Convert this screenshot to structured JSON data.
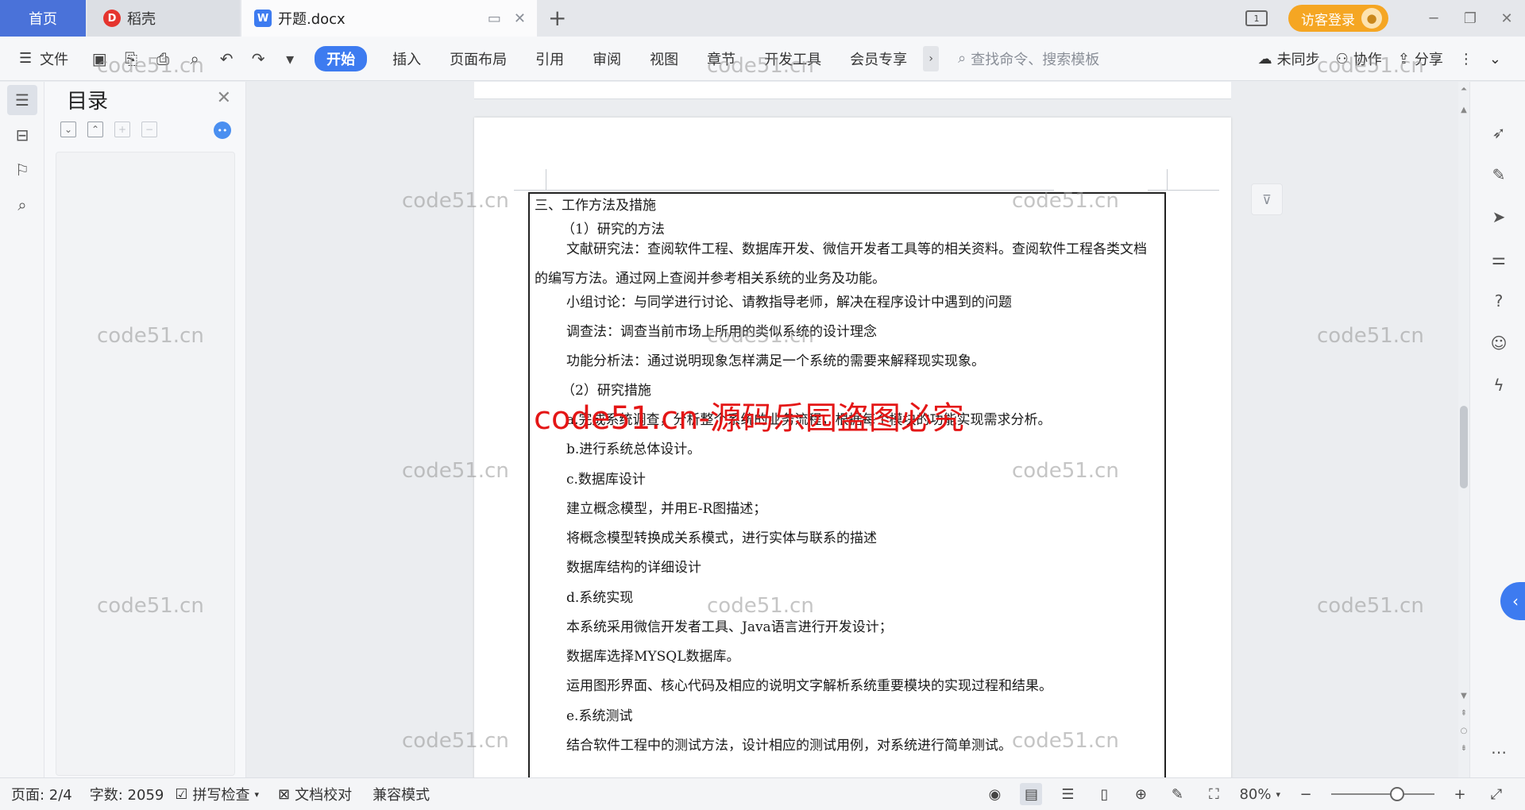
{
  "tabs": {
    "home": "首页",
    "docer": "稻壳",
    "document": "开题.docx",
    "new_tab": "+"
  },
  "titlebar": {
    "login": "访客登录",
    "page_indicator": "1"
  },
  "ribbon": {
    "file": "文件",
    "tabs": [
      "开始",
      "插入",
      "页面布局",
      "引用",
      "审阅",
      "视图",
      "章节",
      "开发工具",
      "会员专享"
    ],
    "search_placeholder": "查找命令、搜索模板",
    "sync": "未同步",
    "collab": "协作",
    "share": "分享"
  },
  "toc": {
    "title": "目录"
  },
  "document": {
    "lines": [
      "三、工作方法及措施",
      "（1）研究的方法",
      "文献研究法：查阅软件工程、数据库开发、微信开发者工具等的相关资料。查阅软件工程各类文档的编写方法。通过网上查阅并参考相关系统的业务及功能。",
      "小组讨论：与同学进行讨论、请教指导老师，解决在程序设计中遇到的问题",
      "调查法：调查当前市场上所用的类似系统的设计理念",
      "功能分析法：通过说明现象怎样满足一个系统的需要来解释现实现象。",
      "（2）研究措施",
      "a.完成系统调查，分析整个系统的业务流程，根据每个模块的功能实现需求分析。",
      "b.进行系统总体设计。",
      "c.数据库设计",
      "建立概念模型，并用E-R图描述；",
      "将概念模型转换成关系模式，进行实体与联系的描述",
      "数据库结构的详细设计",
      "d.系统实现",
      "本系统采用微信开发者工具、Java语言进行开发设计；",
      "数据库选择MYSQL数据库。",
      "运用图形界面、核心代码及相应的说明文字解析系统重要模块的实现过程和结果。",
      "e.系统测试",
      "结合软件工程中的测试方法，设计相应的测试用例，对系统进行简单测试。"
    ]
  },
  "watermarks": {
    "gray": "code51.cn",
    "red": "code51.cn-源码乐园盗图必究"
  },
  "status": {
    "page": "页面: 2/4",
    "words": "字数: 2059",
    "spell": "拼写检查",
    "proof": "文档校对",
    "compat": "兼容模式",
    "zoom": "80%"
  }
}
